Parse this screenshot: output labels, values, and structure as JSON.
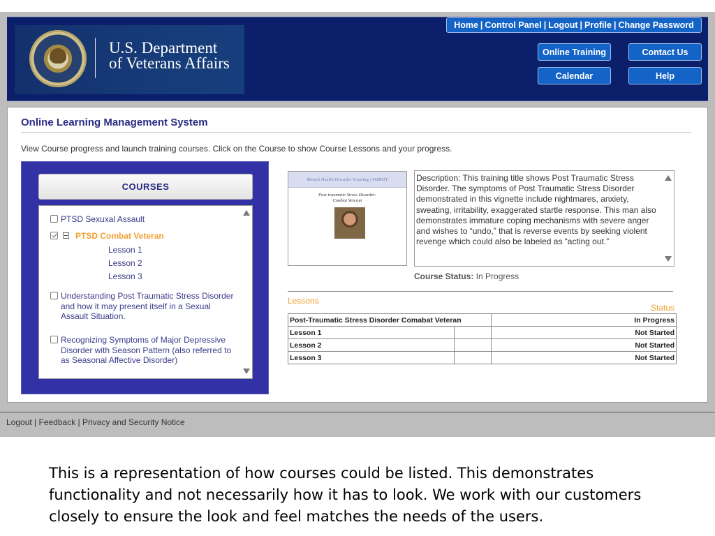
{
  "header": {
    "org_line1": "U.S. Department",
    "org_line2": "of Veterans Affairs",
    "top_links": [
      "Home",
      "Control Panel",
      "Logout",
      "Profile",
      "Change Password"
    ],
    "buttons": {
      "online_training": "Online Training",
      "contact_us": "Contact Us",
      "calendar": "Calendar",
      "help": "Help"
    }
  },
  "main": {
    "title": "Online Learning Management System",
    "intro": "View Course progress and launch training courses. Click on the Course to show Course Lessons and your progress.",
    "courses": {
      "heading": "COURSES",
      "items": [
        {
          "label": "PTSD Sexuxal Assault",
          "checked": false
        },
        {
          "label": "PTSD Combat Veteran",
          "checked": true,
          "expanded": true
        },
        {
          "label": "Understanding Post Traumatic Stress Disorder and how it may present itself in a Sexual Assault Situation.",
          "checked": false
        },
        {
          "label": "Recognizing Symptoms of Major Depressive Disorder with Season Pattern (also referred to as Seasonal Affective Disorder)",
          "checked": false
        }
      ],
      "lessons": [
        "Lesson 1",
        "Lesson 2",
        "Lesson 3"
      ]
    },
    "thumbnail": {
      "band": "Mental Health Disorder Training | #MHDT",
      "subtitle_line1": "Post-traumatic Stress Disorder:",
      "subtitle_line2": "Combat Veteran"
    },
    "description": "Description: This training title shows Post Traumatic Stress Disorder. The symptoms of Post Traumatic Stress Disorder demonstrated in this vignette include nightmares, anxiety, sweating, irritability, exaggerated startle response. This man also demonstrates immature coping mechanisms with severe anger and wishes to “undo,” that is reverse events by seeking violent revenge which could also be labeled as “acting out.”",
    "course_status": {
      "label": "Course Status:",
      "value": "In Progress"
    },
    "lessons_heading": "Lessons",
    "status_heading": "Status",
    "table": {
      "header": {
        "title": "Post-Traumatic Stress Disorder Comabat Veteran",
        "status": "In Progress"
      },
      "rows": [
        {
          "lesson": "Lesson 1",
          "status": "Not Started"
        },
        {
          "lesson": "Lesson 2",
          "status": "Not Started"
        },
        {
          "lesson": "Lesson 3",
          "status": "Not Started"
        }
      ]
    }
  },
  "footer": {
    "links": [
      "Logout",
      "Feedback",
      "Privacy and Security Notice"
    ]
  },
  "caption": "This is a representation of how courses could be listed. This demonstrates functionality and not necessarily how it has to look.  We work with our customers closely to ensure the look and feel matches the needs of the users.",
  "colors": {
    "header_bg": "#0b1f6b",
    "button_bg": "#1463c7",
    "panel_bg": "#3232a6",
    "accent_orange": "#f0a030",
    "title_purple": "#2a2a83"
  },
  "icons": [
    "va-seal-icon",
    "checkbox-icon",
    "collapse-icon",
    "scroll-up-icon",
    "scroll-down-icon"
  ]
}
